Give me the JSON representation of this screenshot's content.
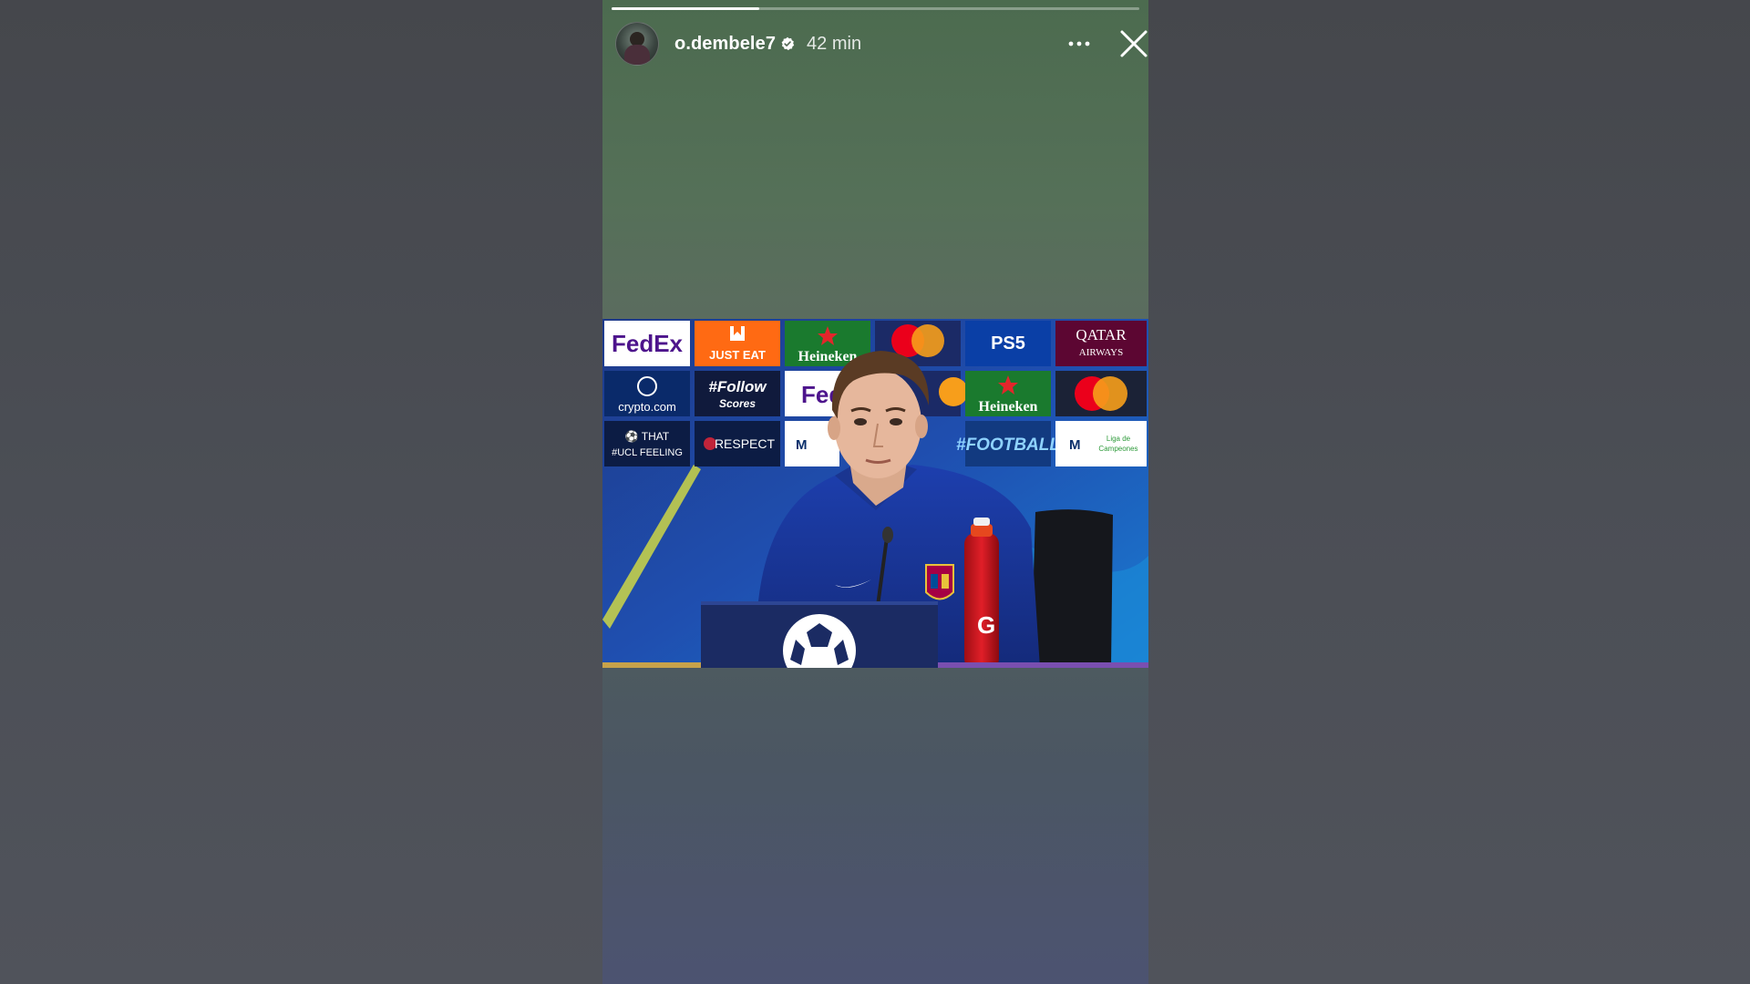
{
  "story": {
    "username": "o.dembele7",
    "timestamp": "42 min",
    "progress": 0.28,
    "verified": true
  },
  "media": {
    "sponsor_board": {
      "row1": [
        "FedEx",
        "JUST EAT",
        "Heineken",
        "mastercard",
        "PS5",
        "QATAR AIRWAYS"
      ],
      "row2": [
        "crypto.com",
        "#Follow Scores",
        "FedEx",
        "mastercard",
        "Heineken",
        "mastercard"
      ],
      "row3": [
        "THAT #UCL FEELING",
        "RESPECT",
        "Liga de Campeones",
        "",
        "#FOOTBALL",
        "Liga de Campeones"
      ]
    },
    "bottle_label": "G"
  },
  "icons": {
    "more": "more-horizontal-icon",
    "close": "close-icon",
    "verified": "verified-badge-icon"
  }
}
